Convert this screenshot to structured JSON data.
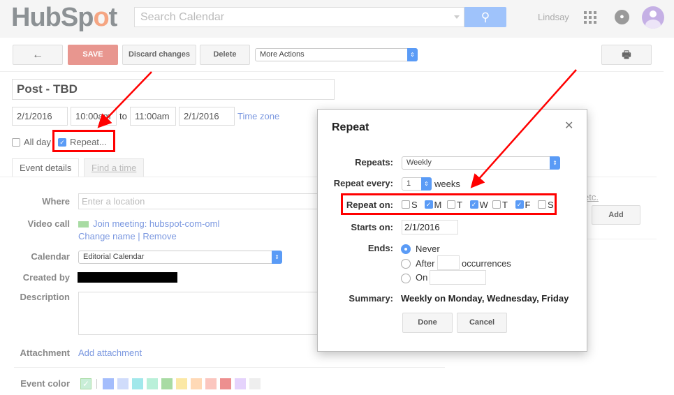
{
  "header": {
    "logo": "HubSpot",
    "search_placeholder": "Search Calendar",
    "user_name": "Lindsay"
  },
  "toolbar": {
    "back": "←",
    "save": "SAVE",
    "discard": "Discard changes",
    "delete": "Delete",
    "more_actions": "More Actions",
    "print": "🖶"
  },
  "event": {
    "title": "Post - TBD",
    "start_date": "2/1/2016",
    "start_time": "10:00am",
    "to": "to",
    "end_time": "11:00am",
    "end_date": "2/1/2016",
    "time_zone": "Time zone",
    "all_day": "All day",
    "all_day_checked": false,
    "repeat": "Repeat...",
    "repeat_checked": true
  },
  "tabs": [
    {
      "label": "Event details",
      "active": true
    },
    {
      "label": "Find a time",
      "active": false
    }
  ],
  "details": {
    "where_label": "Where",
    "where_placeholder": "Enter a location",
    "video_label": "Video call",
    "join_meeting": "Join meeting: hubspot-com-oml",
    "change_name": "Change name",
    "separator": "|",
    "remove": "Remove",
    "calendar_label": "Calendar",
    "calendar_value": "Editorial Calendar",
    "created_by_label": "Created by",
    "description_label": "Description",
    "attachment_label": "Attachment",
    "add_attachment": "Add attachment",
    "event_color_label": "Event color",
    "colors": [
      "#a4bdfc",
      "#d0dcfb",
      "#a2e8eb",
      "#b9f0d9",
      "#a8dba3",
      "#fbe8a5",
      "#ffd9b6",
      "#fbc6bf",
      "#ed8f8f",
      "#e5d3fc",
      "#eeeeee"
    ]
  },
  "guests": {
    "etc_link": "etc.",
    "add": "Add"
  },
  "repeat_dialog": {
    "title": "Repeat",
    "close": "✕",
    "repeats_label": "Repeats:",
    "repeats_value": "Weekly",
    "every_label": "Repeat every:",
    "every_value": "1",
    "every_unit": "weeks",
    "on_label": "Repeat on:",
    "days": [
      {
        "l": "S",
        "c": false
      },
      {
        "l": "M",
        "c": true
      },
      {
        "l": "T",
        "c": false
      },
      {
        "l": "W",
        "c": true
      },
      {
        "l": "T",
        "c": false
      },
      {
        "l": "F",
        "c": true
      },
      {
        "l": "S",
        "c": false
      }
    ],
    "starts_label": "Starts on:",
    "starts_value": "2/1/2016",
    "ends_label": "Ends:",
    "ends_never": "Never",
    "ends_after": "After",
    "occurrences": "occurrences",
    "ends_on": "On",
    "ends_selected": "Never",
    "summary_label": "Summary:",
    "summary_value": "Weekly on Monday, Wednesday, Friday",
    "done": "Done",
    "cancel": "Cancel"
  },
  "colors": {
    "accent": "#5a9bf6",
    "save": "#e8968f",
    "link": "#7b98e0",
    "annotation": "#ff0000"
  }
}
